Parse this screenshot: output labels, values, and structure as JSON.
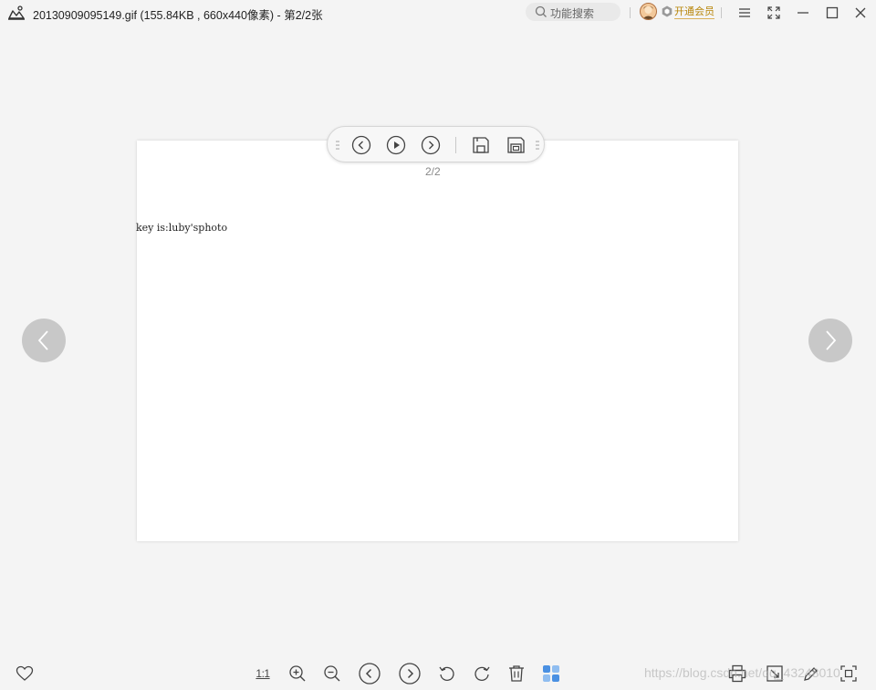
{
  "titlebar": {
    "title": "20130909095149.gif (155.84KB , 660x440像素) - 第2/2张",
    "search_placeholder": "功能搜索",
    "vip_label": "开通会员",
    "icons": [
      "app-logo-icon",
      "search-icon",
      "avatar",
      "vip-badge-icon",
      "menu-icon",
      "fullscreen-icon",
      "minimize-icon",
      "maximize-icon",
      "close-icon"
    ]
  },
  "viewer": {
    "image_text": "key is:luby'sphoto",
    "page_indicator": "2/2",
    "floating_toolbar": [
      "prev-circle-icon",
      "play-icon",
      "next-circle-icon",
      "save-icon",
      "save-as-icon"
    ]
  },
  "bottom_toolbar": {
    "ratio_label": "1:1",
    "icons": [
      "favorite-icon",
      "actual-size-icon",
      "zoom-in-icon",
      "zoom-out-icon",
      "previous-icon",
      "next-icon",
      "rotate-left-icon",
      "rotate-right-icon",
      "delete-icon",
      "thumbnails-icon",
      "print-icon",
      "crop-icon",
      "edit-icon",
      "fit-screen-icon"
    ]
  },
  "watermark": "https://blog.csdn.net/qq_43248010",
  "colors": {
    "background": "#f4f4f4",
    "canvas": "#ffffff",
    "icon": "#444444",
    "side_nav": "#c8c8c8",
    "vip": "#b8860b",
    "thumbnail_accent": "#4a90e2"
  }
}
